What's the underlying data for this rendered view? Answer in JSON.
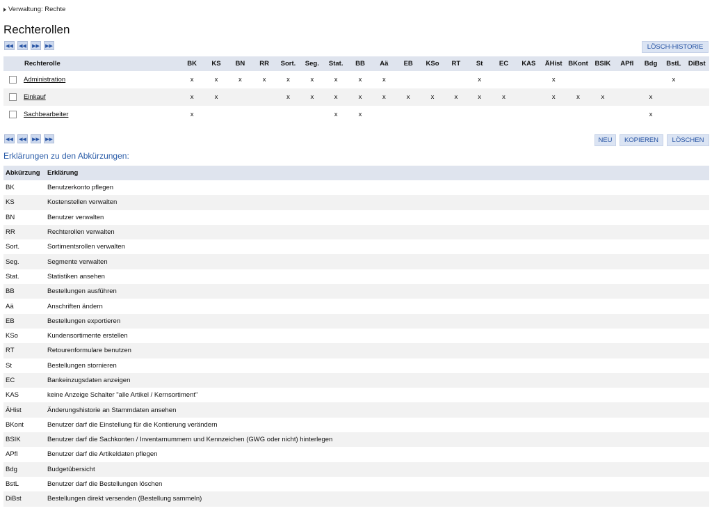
{
  "breadcrumb": "Verwaltung: Rechte",
  "title": "Rechterollen",
  "pager_icons": [
    "first-icon",
    "prev-icon",
    "next-icon",
    "last-icon"
  ],
  "buttons": {
    "history": "LÖSCH-HISTORIE",
    "new": "NEU",
    "copy": "KOPIEREN",
    "delete": "LÖSCHEN"
  },
  "roles_table": {
    "role_header": "Rechterolle",
    "columns": [
      "BK",
      "KS",
      "BN",
      "RR",
      "Sort.",
      "Seg.",
      "Stat.",
      "BB",
      "Aä",
      "EB",
      "KSo",
      "RT",
      "St",
      "EC",
      "KAS",
      "ÄHist",
      "BKont",
      "BSIK",
      "APfl",
      "Bdg",
      "BstL",
      "DiBst"
    ],
    "rows": [
      {
        "name": "Administration",
        "cells": [
          "x",
          "x",
          "x",
          "x",
          "x",
          "x",
          "x",
          "x",
          "x",
          "",
          "",
          "",
          "x",
          "",
          "",
          "x",
          "",
          "",
          "",
          "",
          "x",
          ""
        ]
      },
      {
        "name": "Einkauf",
        "cells": [
          "x",
          "x",
          "",
          "",
          "x",
          "x",
          "x",
          "x",
          "x",
          "x",
          "x",
          "x",
          "x",
          "x",
          "",
          "x",
          "x",
          "x",
          "",
          "x",
          "",
          ""
        ]
      },
      {
        "name": "Sachbearbeiter",
        "cells": [
          "x",
          "",
          "",
          "",
          "",
          "",
          "x",
          "x",
          "",
          "",
          "",
          "",
          "",
          "",
          "",
          "",
          "",
          "",
          "",
          "x",
          "",
          ""
        ]
      }
    ]
  },
  "section_title": "Erklärungen zu den Abkürzungen:",
  "abbr_table": {
    "headers": [
      "Abkürzung",
      "Erklärung"
    ],
    "rows": [
      [
        "BK",
        "Benutzerkonto pflegen"
      ],
      [
        "KS",
        "Kostenstellen verwalten"
      ],
      [
        "BN",
        "Benutzer verwalten"
      ],
      [
        "RR",
        "Rechterollen verwalten"
      ],
      [
        "Sort.",
        "Sortimentsrollen verwalten"
      ],
      [
        "Seg.",
        "Segmente verwalten"
      ],
      [
        "Stat.",
        "Statistiken ansehen"
      ],
      [
        "BB",
        "Bestellungen ausführen"
      ],
      [
        "Aä",
        "Anschriften ändern"
      ],
      [
        "EB",
        "Bestellungen exportieren"
      ],
      [
        "KSo",
        "Kundensortimente erstellen"
      ],
      [
        "RT",
        "Retourenformulare benutzen"
      ],
      [
        "St",
        "Bestellungen stornieren"
      ],
      [
        "EC",
        "Bankeinzugsdaten anzeigen"
      ],
      [
        "KAS",
        "keine Anzeige Schalter \"alle Artikel / Kernsortiment\""
      ],
      [
        "ÄHist",
        "Änderungshistorie an Stammdaten ansehen"
      ],
      [
        "BKont",
        "Benutzer darf die Einstellung für die Kontierung verändern"
      ],
      [
        "BSIK",
        "Benutzer darf die Sachkonten / Inventarnummern und Kennzeichen (GWG oder nicht) hinterlegen"
      ],
      [
        "APfl",
        "Benutzer darf die Artikeldaten pflegen"
      ],
      [
        "Bdg",
        "Budgetübersicht"
      ],
      [
        "BstL",
        "Benutzer darf die Bestellungen löschen"
      ],
      [
        "DiBst",
        "Bestellungen direkt versenden (Bestellung sammeln)"
      ]
    ]
  }
}
